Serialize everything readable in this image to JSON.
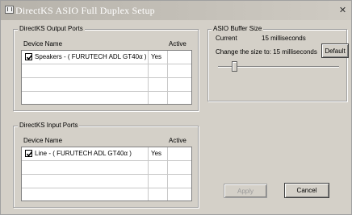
{
  "window": {
    "title": "DirectKS  ASIO Full Duplex Setup",
    "close_glyph": "✕"
  },
  "output_ports": {
    "group_label": "DirectKS Output Ports",
    "columns": {
      "device": "Device Name",
      "active": "Active"
    },
    "rows": [
      {
        "checked": true,
        "device": "Speakers - ( FURUTECH ADL GT40α )",
        "active": "Yes"
      }
    ]
  },
  "input_ports": {
    "group_label": "DirectKS Input Ports",
    "columns": {
      "device": "Device Name",
      "active": "Active"
    },
    "rows": [
      {
        "checked": true,
        "device": "Line - ( FURUTECH ADL GT40α )",
        "active": "Yes"
      }
    ]
  },
  "buffer": {
    "group_label": "ASIO Buffer Size",
    "current_label": "Current",
    "current_value": "15 milliseconds",
    "change_text": "Change the size to: 15 milliseconds",
    "default_button": "Default",
    "slider_level_fraction": 0.12
  },
  "actions": {
    "apply": "Apply",
    "cancel": "Cancel"
  },
  "colors": {
    "dialog_bg": "#d4d0c8",
    "list_bg": "#ffffff",
    "disabled_text": "#9a9a9a"
  }
}
